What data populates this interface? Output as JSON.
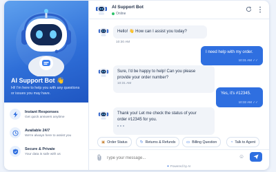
{
  "sidebar": {
    "title": "AI Support Bot",
    "wave": "👋",
    "subtitle": "Hi! I'm here to help you with any questions or issues you may have.",
    "features": [
      {
        "title": "Instant Responses",
        "desc": "Get quick answers anytime",
        "icon": "lightning-icon"
      },
      {
        "title": "Available 24/7",
        "desc": "We're always here to assist you",
        "icon": "clock-icon"
      },
      {
        "title": "Secure & Private",
        "desc": "Your data is safe with us",
        "icon": "shield-icon"
      }
    ]
  },
  "header": {
    "name": "AI Support Bot",
    "status": "Online"
  },
  "messages": [
    {
      "from": "bot",
      "text": "Hello! 👋 How can I assist you today?",
      "time": "10:30 AM"
    },
    {
      "from": "user",
      "text": "I need help with my order.",
      "time": "10:31 AM"
    },
    {
      "from": "bot",
      "text_line1": "Sure, I'd be happy to help! Can you please",
      "text_line2": "provide your order number?",
      "time": "10:31 AM"
    },
    {
      "from": "user",
      "text": "Yes, it's #12345.",
      "time": "10:32 AM"
    },
    {
      "from": "bot",
      "text_line1": "Thank you! Let me check the status of your",
      "text_line2": "order #12345 for you."
    }
  ],
  "quick_replies": [
    {
      "label": "Order Status",
      "icon": "box-icon"
    },
    {
      "label": "Returns & Refunds",
      "icon": "return-icon"
    },
    {
      "label": "Billing Question",
      "icon": "card-icon"
    },
    {
      "label": "Talk to Agent",
      "icon": "headset-icon"
    }
  ],
  "composer": {
    "placeholder": "Type your message...",
    "powered_by": "Powered by AI"
  },
  "colors": {
    "accent": "#2f6fe0",
    "online": "#2ec26b",
    "bot_bubble": "#f1f4f9"
  }
}
